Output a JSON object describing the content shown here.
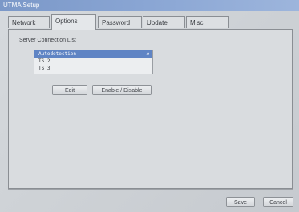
{
  "window": {
    "title": "UTMA Setup"
  },
  "tabs": [
    {
      "label": "Network",
      "active": false
    },
    {
      "label": "Options",
      "active": true
    },
    {
      "label": "Password",
      "active": false
    },
    {
      "label": "Update",
      "active": false
    },
    {
      "label": "Misc.",
      "active": false
    }
  ],
  "server_list": {
    "label": "Server Connection List",
    "items": [
      "Autodetection",
      "TS 2",
      "TS 3"
    ],
    "selected_index": 0
  },
  "buttons": {
    "edit": "Edit",
    "enable_disable": "Enable / Disable",
    "save": "Save",
    "cancel": "Cancel"
  },
  "colors": {
    "titlebar": "#8aa6d4",
    "selection": "#5f84c4"
  }
}
